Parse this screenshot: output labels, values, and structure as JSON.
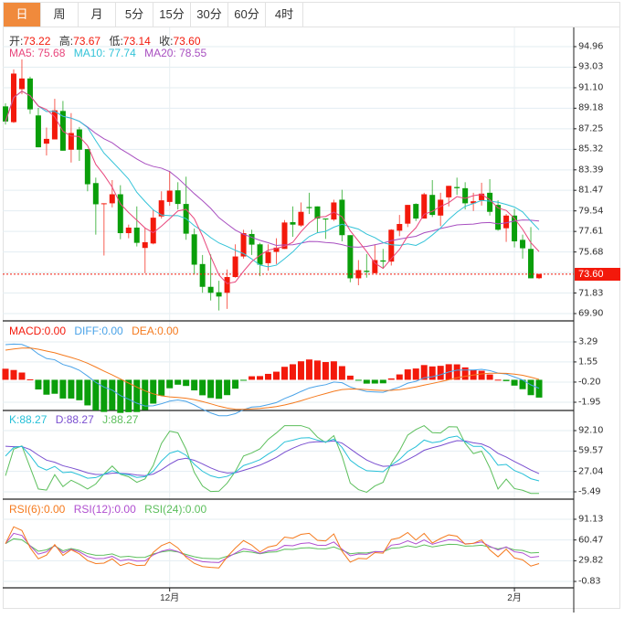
{
  "tabs": [
    {
      "label": "日",
      "active": true
    },
    {
      "label": "周",
      "active": false
    },
    {
      "label": "月",
      "active": false
    },
    {
      "label": "5分",
      "active": false
    },
    {
      "label": "15分",
      "active": false
    },
    {
      "label": "30分",
      "active": false
    },
    {
      "label": "60分",
      "active": false
    },
    {
      "label": "4时",
      "active": false
    }
  ],
  "ohlc_legend": {
    "open_label": "开:",
    "open": "73.22",
    "high_label": "高:",
    "high": "73.67",
    "low_label": "低:",
    "low": "73.14",
    "close_label": "收:",
    "close": "73.60"
  },
  "ma_legend": {
    "ma5": "MA5: 75.68",
    "ma10": "MA10: 77.74",
    "ma20": "MA20: 78.55"
  },
  "macd_legend": {
    "macd": "MACD:0.00",
    "diff": "DIFF:0.00",
    "dea": "DEA:0.00"
  },
  "kdj_legend": {
    "k": "K:88.27",
    "d": "D:88.27",
    "j": "J:88.27"
  },
  "rsi_legend": {
    "rsi6": "RSI(6):0.00",
    "rsi12": "RSI(12):0.00",
    "rsi24": "RSI(24):0.00"
  },
  "colors": {
    "up": "#f3190b",
    "down": "#0a9e0a",
    "ma5": "#e8467c",
    "ma10": "#33c3d8",
    "ma20": "#a84fc0",
    "diff": "#4aa3e8",
    "dea": "#f57a1e",
    "k": "#27c0d8",
    "d": "#7a4fd0",
    "j": "#5cbf5c",
    "rsi6": "#f57a1e",
    "rsi12": "#b04fd0",
    "rsi24": "#5cbf5c",
    "accent": "#f08a3c"
  },
  "chart_data": {
    "type": "candlestick",
    "title": "",
    "last_price": "73.60",
    "price_axis": [
      "94.96",
      "93.03",
      "91.10",
      "89.18",
      "87.25",
      "85.32",
      "83.39",
      "81.47",
      "79.54",
      "77.61",
      "75.68",
      "73.60",
      "71.83",
      "69.90"
    ],
    "price_grid": [
      94.96,
      93.03,
      91.1,
      89.18,
      87.25,
      85.32,
      83.39,
      81.47,
      79.54,
      77.61,
      75.68,
      73.75,
      71.83,
      69.9
    ],
    "x_labels": [
      {
        "label": "12月",
        "index": 20
      },
      {
        "label": "2月",
        "index": 62
      }
    ],
    "candles": [
      [
        89.35,
        89.64,
        87.64,
        87.93
      ],
      [
        87.87,
        92.82,
        87.79,
        92.43
      ],
      [
        90.97,
        93.76,
        90.49,
        91.97
      ],
      [
        91.97,
        92.14,
        88.64,
        89.07
      ],
      [
        88.5,
        89.21,
        85.51,
        85.51
      ],
      [
        85.85,
        87.36,
        84.74,
        86.3
      ],
      [
        86.25,
        90.06,
        86.25,
        88.98
      ],
      [
        88.92,
        89.86,
        85.19,
        85.19
      ],
      [
        85.28,
        88.72,
        84.08,
        86.85
      ],
      [
        87.19,
        87.42,
        84.23,
        85.28
      ],
      [
        85.34,
        85.34,
        81.38,
        82.04
      ],
      [
        82.15,
        82.66,
        77.31,
        80.16
      ],
      [
        80.22,
        80.25,
        75.35,
        80.25
      ],
      [
        80.25,
        82.43,
        79.87,
        81.1
      ],
      [
        81.1,
        81.95,
        76.88,
        77.45
      ],
      [
        77.45,
        78.25,
        76.97,
        77.97
      ],
      [
        77.97,
        79.96,
        76.2,
        76.54
      ],
      [
        76.06,
        77.97,
        73.69,
        76.6
      ],
      [
        76.48,
        79.67,
        76.4,
        78.9
      ],
      [
        79.02,
        81.38,
        78.82,
        80.53
      ],
      [
        80.38,
        83.29,
        80.02,
        81.44
      ],
      [
        81.47,
        82.23,
        79.67,
        80.19
      ],
      [
        80.19,
        82.75,
        76.83,
        77.4
      ],
      [
        77.34,
        77.88,
        73.55,
        74.49
      ],
      [
        74.55,
        75.4,
        71.85,
        72.41
      ],
      [
        72.41,
        75.46,
        71.13,
        71.85
      ],
      [
        71.9,
        72.98,
        70.19,
        71.5
      ],
      [
        71.85,
        74.04,
        70.34,
        73.33
      ],
      [
        73.33,
        76.4,
        73.27,
        75.26
      ],
      [
        75.26,
        77.77,
        75.06,
        77.45
      ],
      [
        77.37,
        77.77,
        75.4,
        76.37
      ],
      [
        76.4,
        76.54,
        73.41,
        74.49
      ],
      [
        74.63,
        76.4,
        73.92,
        75.69
      ],
      [
        75.69,
        76.97,
        74.55,
        76.09
      ],
      [
        75.97,
        78.68,
        75.97,
        78.45
      ],
      [
        78.48,
        79.96,
        77.11,
        78.25
      ],
      [
        78.17,
        80.33,
        78.05,
        79.45
      ],
      [
        79.9,
        81.24,
        79.25,
        79.8
      ],
      [
        79.96,
        79.96,
        77.48,
        78.82
      ],
      [
        78.82,
        78.82,
        76.91,
        78.73
      ],
      [
        78.73,
        80.59,
        78.59,
        80.33
      ],
      [
        80.59,
        81.52,
        76.68,
        77.26
      ],
      [
        77.26,
        77.26,
        72.84,
        73.21
      ],
      [
        73.21,
        74.92,
        72.56,
        73.98
      ],
      [
        73.92,
        75.49,
        73.27,
        73.81
      ],
      [
        73.69,
        76.4,
        73.69,
        74.92
      ],
      [
        74.89,
        75.97,
        74.12,
        74.78
      ],
      [
        74.78,
        77.82,
        74.41,
        77.77
      ],
      [
        77.68,
        79.16,
        77.17,
        78.31
      ],
      [
        78.34,
        80.1,
        78.02,
        80.1
      ],
      [
        80.19,
        80.25,
        78.59,
        78.82
      ],
      [
        78.82,
        81.24,
        78.82,
        81.1
      ],
      [
        81.04,
        82.43,
        78.96,
        79.16
      ],
      [
        79.1,
        81.24,
        78.11,
        80.59
      ],
      [
        80.81,
        81.89,
        79.96,
        81.89
      ],
      [
        81.78,
        82.66,
        81.04,
        81.67
      ],
      [
        81.67,
        82.23,
        79.67,
        80.25
      ],
      [
        80.25,
        81.24,
        79.53,
        80.44
      ],
      [
        80.53,
        82.18,
        80.04,
        81.16
      ],
      [
        81.24,
        82.52,
        79.1,
        79.45
      ],
      [
        80.1,
        80.53,
        77.68,
        77.77
      ],
      [
        77.91,
        79.25,
        76.63,
        79.1
      ],
      [
        79.1,
        79.73,
        76.11,
        76.68
      ],
      [
        76.82,
        77.31,
        75.06,
        76.03
      ],
      [
        75.97,
        78.02,
        73.21,
        73.21
      ],
      [
        73.22,
        73.67,
        73.14,
        73.6
      ]
    ],
    "macd_axis": [
      "3.29",
      "1.55",
      "-0.20",
      "-1.95"
    ],
    "kdj_axis": [
      "92.10",
      "59.57",
      "27.04",
      "-5.49"
    ],
    "rsi_axis": [
      "91.13",
      "60.47",
      "29.82",
      "-0.83"
    ]
  }
}
